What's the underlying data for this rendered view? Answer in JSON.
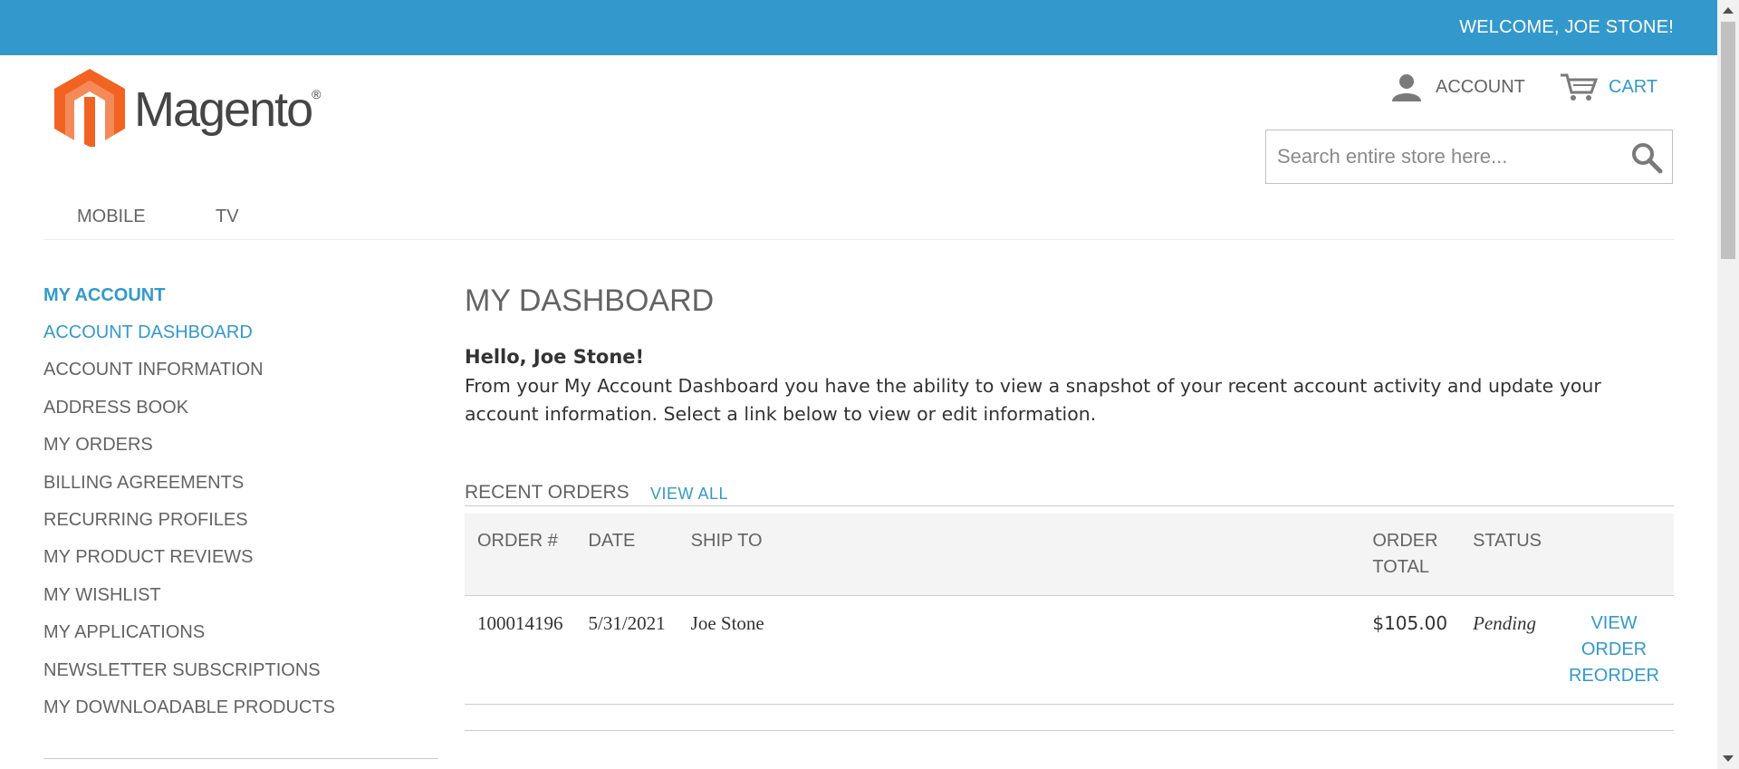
{
  "header": {
    "welcome": "WELCOME, JOE STONE!",
    "logo_text": "Magento",
    "logo_mark": "®",
    "account_label": "ACCOUNT",
    "cart_label": "CART"
  },
  "search": {
    "placeholder": "Search entire store here..."
  },
  "nav": {
    "items": [
      "MOBILE",
      "TV"
    ]
  },
  "sidebar": {
    "title": "MY ACCOUNT",
    "items": [
      "ACCOUNT DASHBOARD",
      "ACCOUNT INFORMATION",
      "ADDRESS BOOK",
      "MY ORDERS",
      "BILLING AGREEMENTS",
      "RECURRING PROFILES",
      "MY PRODUCT REVIEWS",
      "MY WISHLIST",
      "MY APPLICATIONS",
      "NEWSLETTER SUBSCRIPTIONS",
      "MY DOWNLOADABLE PRODUCTS"
    ],
    "active_index": 0
  },
  "main": {
    "title": "MY DASHBOARD",
    "hello": "Hello, Joe Stone!",
    "intro": "From your My Account Dashboard you have the ability to view a snapshot of your recent account activity and update your account information. Select a link below to view or edit information.",
    "recent_title": "RECENT ORDERS",
    "view_all": "VIEW ALL"
  },
  "orders": {
    "columns": [
      "ORDER #",
      "DATE",
      "SHIP TO",
      "ORDER TOTAL",
      "STATUS",
      ""
    ],
    "rows": [
      {
        "order": "100014196",
        "date": "5/31/2021",
        "ship_to": "Joe Stone",
        "total": "$105.00",
        "status": "Pending",
        "view": "VIEW ORDER",
        "reorder": "REORDER"
      }
    ]
  },
  "colors": {
    "accent": "#3399cc",
    "logo_orange": "#f26322",
    "text": "#636363"
  }
}
